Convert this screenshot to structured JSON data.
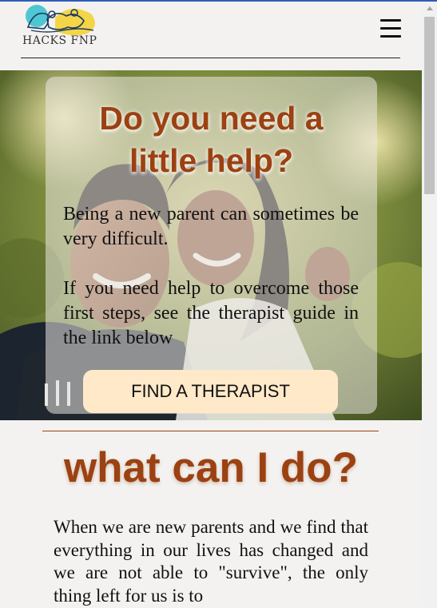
{
  "brand": {
    "logo_text": "HACKS FNP"
  },
  "header": {
    "menu_icon": "hamburger-menu-icon"
  },
  "hero": {
    "title_line1": "Do you need a",
    "title_line2": "little help?",
    "paragraph1": "Being a new parent can sometimes be very difficult.",
    "paragraph2": "If you need help to overcome those first steps, see the therapist guide in the link below",
    "cta_label": "FIND A THERAPIST"
  },
  "section": {
    "title": "what can I do?",
    "body": "When we are new parents and we find that everything in our lives has changed and we are not able to \"survive\", the only thing left for us is to"
  },
  "colors": {
    "accent": "#9c4112",
    "cta_background": "#ffe9c9",
    "page_background": "#f4f2f0"
  }
}
